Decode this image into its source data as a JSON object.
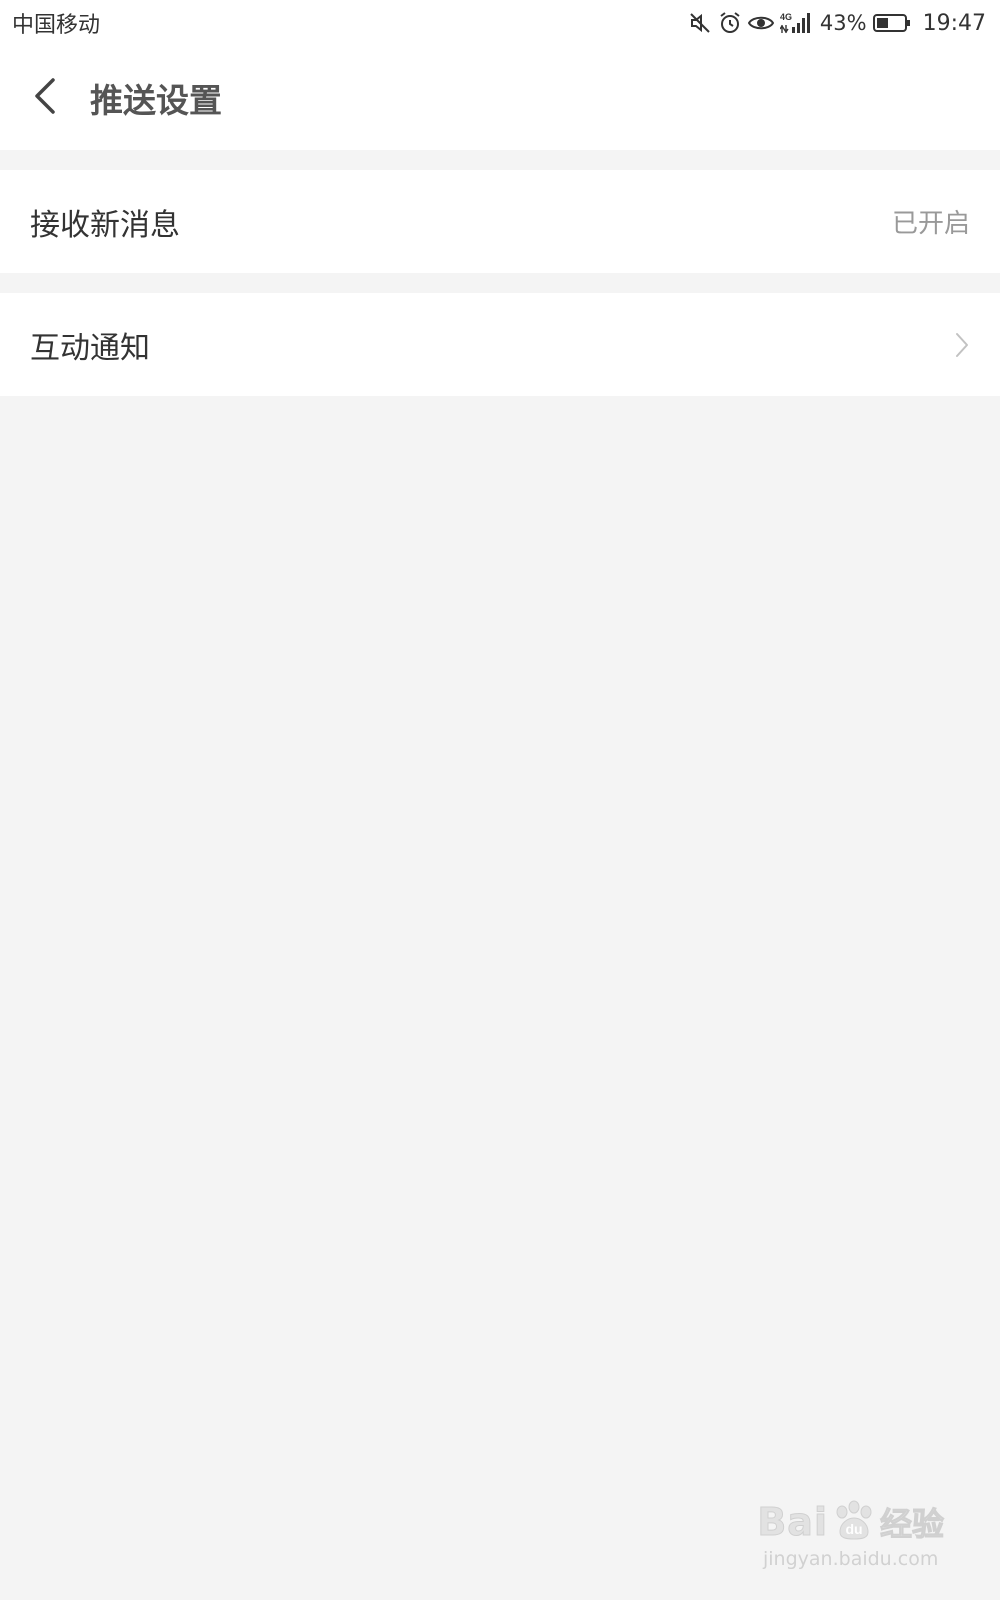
{
  "status_bar": {
    "carrier": "中国移动",
    "network_label": "4G",
    "battery_percent": "43%",
    "battery_level": 0.43,
    "time": "19:47",
    "icons": [
      "mute-icon",
      "alarm-icon",
      "eye-icon",
      "signal-icon",
      "battery-icon"
    ]
  },
  "header": {
    "title": "推送设置",
    "back_icon": "chevron-left-icon"
  },
  "settings": {
    "receive_new_messages": {
      "label": "接收新消息",
      "value": "已开启"
    },
    "interaction_notifications": {
      "label": "互动通知",
      "icon": "chevron-right-icon"
    }
  },
  "watermark": {
    "brand": "Bai",
    "brand_suffix": "du",
    "cn": "经验",
    "url": "jingyan.baidu.com"
  }
}
